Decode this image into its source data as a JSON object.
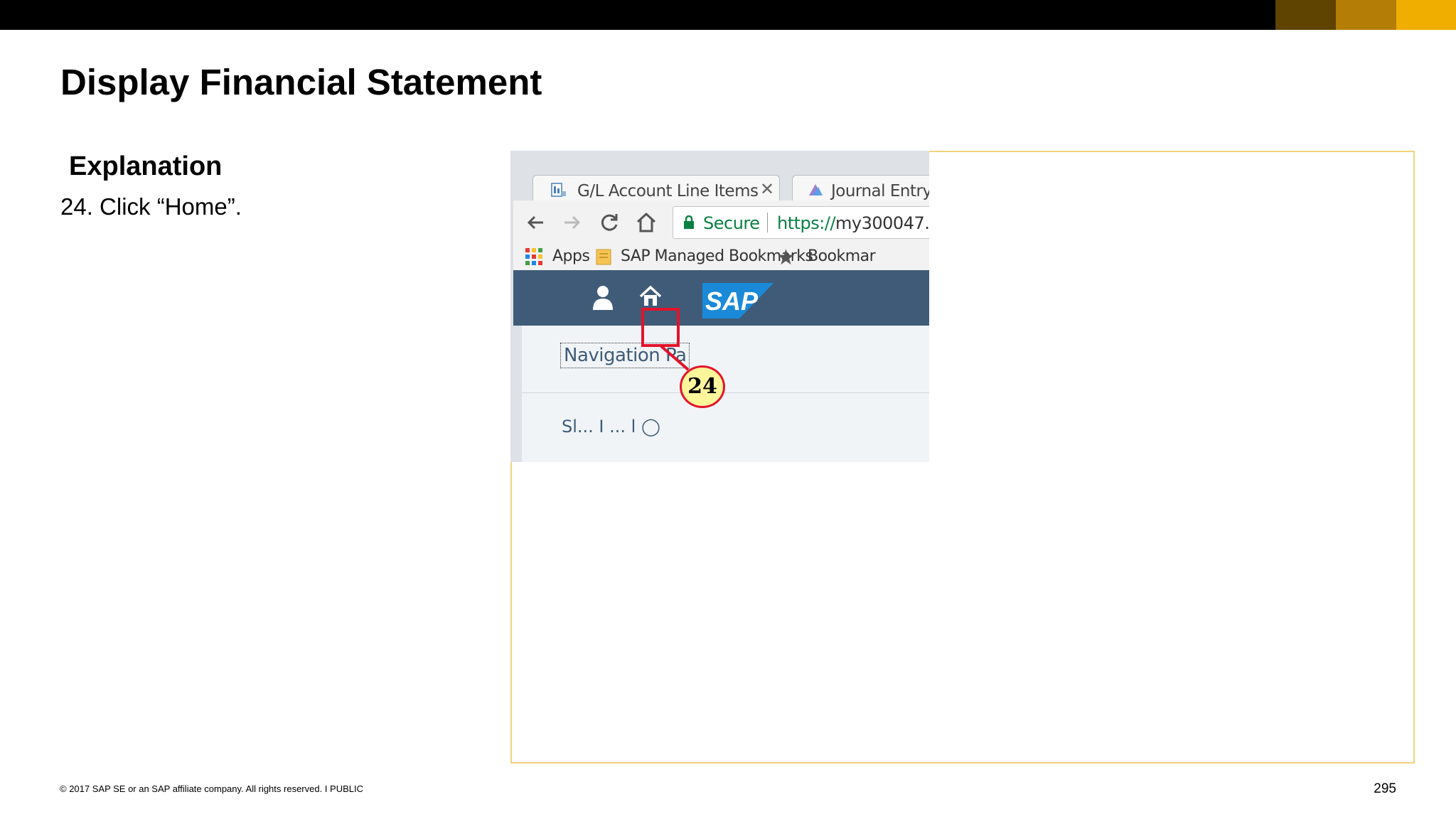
{
  "slide": {
    "title": "Display Financial Statement",
    "explanation_heading": "Explanation",
    "step_text": "24. Click “Home”.",
    "footer": "© 2017 SAP SE or an SAP affiliate company. All rights reserved.   I   PUBLIC",
    "page_number": "295"
  },
  "browser": {
    "tabs": [
      {
        "label": "G/L Account Line Items",
        "icon": "report-icon",
        "close": "✕"
      },
      {
        "label": "Journal Entry An",
        "icon": "app-icon"
      }
    ],
    "omnibox": {
      "secure_label": "Secure",
      "url_scheme": "https://",
      "url_rest": "my300047."
    },
    "bookmarks": {
      "apps_label": "Apps",
      "folder_label": "SAP Managed Bookmarks",
      "bookmark2_label": "Bookmar"
    }
  },
  "shell": {
    "brand": "SAP",
    "nav_panel_label": "Navigation Pa",
    "cut_text": "Sl... I ... l ◯"
  },
  "callout": {
    "number": "24"
  },
  "colors": {
    "shell_bg": "#3f5b78",
    "highlight": "#e3142b",
    "callout_fill": "#fff69b",
    "frame_border": "#f2d27a",
    "sap_blue": "#1a8ad8"
  }
}
